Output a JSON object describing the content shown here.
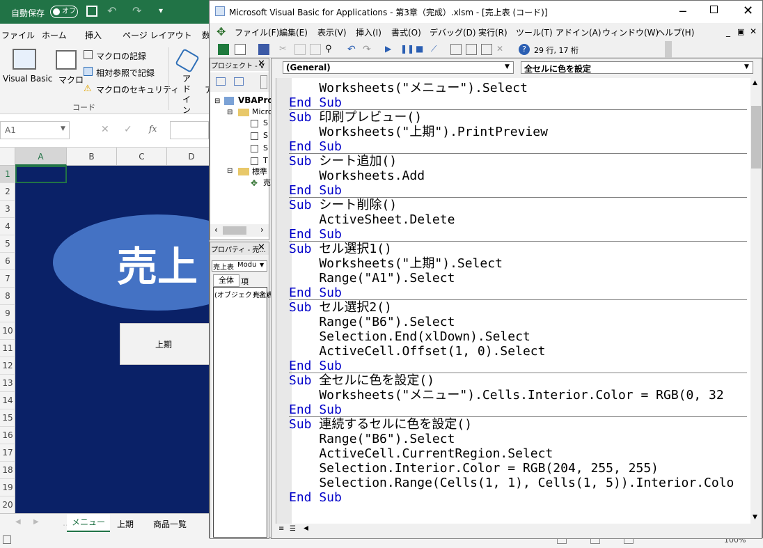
{
  "excel": {
    "qat": {
      "autosave": "自動保存",
      "autosave_state": "オフ"
    },
    "tabs": [
      "ファイル",
      "ホーム",
      "挿入",
      "ページ レイアウト",
      "数"
    ],
    "ribbon": {
      "visual_basic": "Visual Basic",
      "macro": "マクロ",
      "record_macro": "マクロの記録",
      "relative_ref": "相対参照で記録",
      "macro_security": "マクロのセキュリティ",
      "group_code": "コード",
      "addin": "アド\nイン",
      "addin_short": "ア"
    },
    "namebox": "A1",
    "columns": [
      "A",
      "B",
      "C",
      "D"
    ],
    "rows": [
      "1",
      "2",
      "3",
      "4",
      "5",
      "6",
      "7",
      "8",
      "9",
      "10",
      "11",
      "12",
      "13",
      "14",
      "15",
      "16",
      "17",
      "18",
      "19",
      "20"
    ],
    "banner_text": "売上",
    "button_text": "上期",
    "sheet_tabs": [
      "メニュー",
      "上期",
      "商品一覧"
    ]
  },
  "vbe": {
    "title": "Microsoft Visual Basic for Applications - 第3章（完成）.xlsm - [売上表 (コード)]",
    "menu": [
      "ファイル(F)",
      "編集(E)",
      "表示(V)",
      "挿入(I)",
      "書式(O)",
      "デバッグ(D)",
      "実行(R)",
      "ツール(T)",
      "アドイン(A)",
      "ウィンドウ(W)",
      "ヘルプ(H)"
    ],
    "cursor_pos": "29 行, 17 桁",
    "project": {
      "header": "プロジェクト - V",
      "root": "VBAPro",
      "folder1": "Micro",
      "items": [
        "S",
        "S",
        "S",
        "T"
      ],
      "folder2": "標準",
      "module": "売"
    },
    "properties": {
      "header": "プロパティ - 売...",
      "object": "売上表",
      "object_type": "Modu",
      "tab_all": "全体",
      "tab_cat": "項",
      "row": "(オブジェクト名)",
      "row_value": "売上表"
    },
    "combo_object": "(General)",
    "combo_proc": "全セルに色を設定",
    "code_lines": [
      {
        "text": "    Worksheets(\"メニュー\").Select",
        "kw": false
      },
      {
        "text": "End Sub",
        "kw": true,
        "sep_after": true
      },
      {
        "kw1": "Sub",
        "rest": " 印刷プレビュー()"
      },
      {
        "text": "    Worksheets(\"上期\").PrintPreview",
        "kw": false
      },
      {
        "text": "End Sub",
        "kw": true,
        "sep_after": true
      },
      {
        "kw1": "Sub",
        "rest": " シート追加()"
      },
      {
        "text": "    Worksheets.Add",
        "kw": false
      },
      {
        "text": "End Sub",
        "kw": true,
        "sep_after": true
      },
      {
        "kw1": "Sub",
        "rest": " シート削除()"
      },
      {
        "text": "    ActiveSheet.Delete",
        "kw": false
      },
      {
        "text": "End Sub",
        "kw": true,
        "sep_after": true
      },
      {
        "kw1": "Sub",
        "rest": " セル選択1()"
      },
      {
        "text": "    Worksheets(\"上期\").Select",
        "kw": false
      },
      {
        "text": "    Range(\"A1\").Select",
        "kw": false
      },
      {
        "text": "End Sub",
        "kw": true,
        "sep_after": true
      },
      {
        "kw1": "Sub",
        "rest": " セル選択2()"
      },
      {
        "text": "    Range(\"B6\").Select",
        "kw": false
      },
      {
        "text": "    Selection.End(xlDown).Select",
        "kw": false
      },
      {
        "text": "    ActiveCell.Offset(1, 0).Select",
        "kw": false
      },
      {
        "text": "End Sub",
        "kw": true,
        "sep_after": true
      },
      {
        "kw1": "Sub",
        "rest": " 全セルに色を設定()"
      },
      {
        "text": "    Worksheets(\"メニュー\").Cells.Interior.Color = RGB(0, 32",
        "kw": false
      },
      {
        "text": "End Sub",
        "kw": true,
        "sep_after": true
      },
      {
        "kw1": "Sub",
        "rest": " 連続するセルに色を設定()"
      },
      {
        "text": "    Range(\"B6\").Select",
        "kw": false
      },
      {
        "text": "    ActiveCell.CurrentRegion.Select",
        "kw": false
      },
      {
        "text": "    Selection.Interior.Color = RGB(204, 255, 255)",
        "kw": false
      },
      {
        "text": "    Selection.Range(Cells(1, 1), Cells(1, 5)).Interior.Colo",
        "kw": false
      },
      {
        "text": "End Sub",
        "kw": true
      }
    ],
    "status_right": "100%"
  },
  "colors": {
    "excel_green": "#217346",
    "sheet_bg": "#0a2167",
    "banner": "#4472c4",
    "keyword": "#0000c8"
  }
}
